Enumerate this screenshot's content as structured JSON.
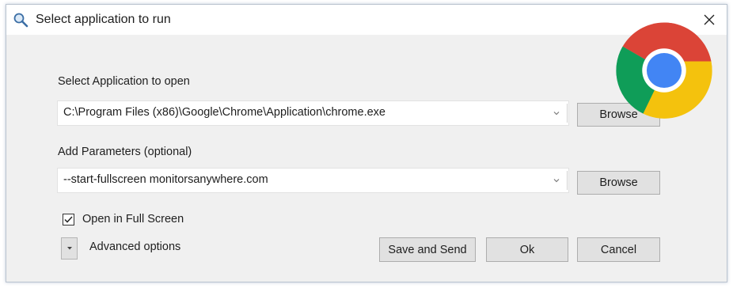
{
  "window": {
    "title": "Select application to run"
  },
  "icons": {
    "title_icon": "magnifier-icon",
    "close_icon": "close-icon",
    "logo": "chrome-logo",
    "dropdown_arrow": "chevron-down-icon",
    "checkmark": "checkmark-icon"
  },
  "application": {
    "label": "Select Application to open",
    "value": "C:\\Program Files (x86)\\Google\\Chrome\\Application\\chrome.exe",
    "browse_label": "Browse"
  },
  "parameters": {
    "label": "Add Parameters (optional)",
    "value": "--start-fullscreen monitorsanywhere.com",
    "browse_label": "Browse"
  },
  "fullscreen": {
    "label": "Open in Full Screen",
    "checked": true
  },
  "advanced": {
    "label": "Advanced options"
  },
  "footer": {
    "save_send_label": "Save and Send",
    "ok_label": "Ok",
    "cancel_label": "Cancel"
  },
  "colors": {
    "dialog_bg": "#f0f0f0",
    "title_bg": "#ffffff",
    "button_bg": "#e1e1e1",
    "button_border": "#adadad",
    "chrome_red": "#db4437",
    "chrome_yellow": "#f4c20d",
    "chrome_green": "#0f9d58",
    "chrome_blue": "#4285f4"
  }
}
